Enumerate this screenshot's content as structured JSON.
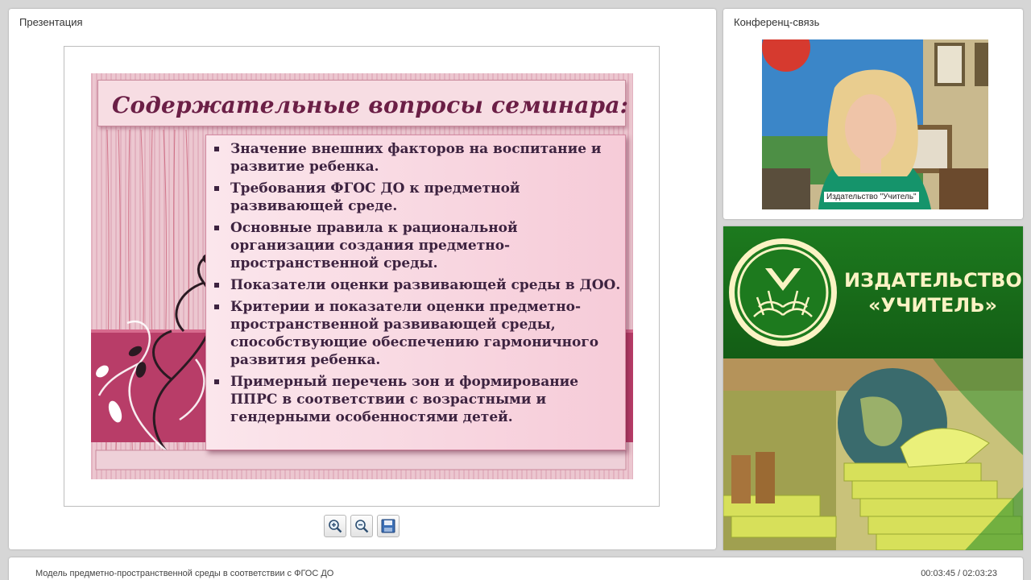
{
  "presentation_panel": {
    "title": "Презентация"
  },
  "conference_panel": {
    "title": "Конференц-связь",
    "camera_label": "Издательство \"Учитель\""
  },
  "slide": {
    "title": "Содержательные вопросы семинара:",
    "bullets": [
      "Значение внешних факторов на воспитание и развитие ребенка.",
      "Требования ФГОС ДО к предметной развивающей среде.",
      "Основные правила к рациональной организации создания предметно-пространственной среды.",
      "Показатели оценки развивающей среды в ДОО.",
      "Критерии и показатели оценки предметно-пространственной развивающей среды, способствующие обеспечению гармоничного развития ребенка.",
      "Примерный перечень зон и формирование ППРС в соответствии с возрастными и гендерными особенностями детей."
    ]
  },
  "toolbar": {
    "icons": [
      "zoom-in-icon",
      "zoom-out-icon",
      "save-icon"
    ]
  },
  "publisher": {
    "name_line1": "ИЗДАТЕЛЬСТВО",
    "name_line2": "«УЧИТЕЛЬ»"
  },
  "bottom_bar": {
    "title": "Модель предметно-пространственной среды в соответствии с ФГОС ДО",
    "time": "00:03:45 / 02:03:23"
  },
  "colors": {
    "slide_title": "#6b1f46",
    "slide_text": "#3d2340",
    "publisher_green": "#1d7a1e",
    "publisher_text": "#fbf3c4"
  }
}
